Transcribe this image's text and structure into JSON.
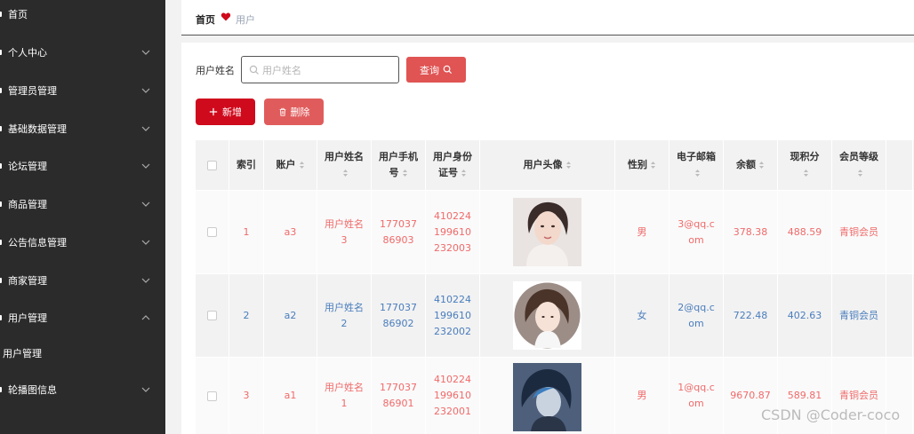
{
  "sidebar": {
    "items": [
      {
        "label": "首页",
        "has_chevron": false
      },
      {
        "label": "个人中心",
        "has_chevron": true
      },
      {
        "label": "管理员管理",
        "has_chevron": true
      },
      {
        "label": "基础数据管理",
        "has_chevron": true
      },
      {
        "label": "论坛管理",
        "has_chevron": true
      },
      {
        "label": "商品管理",
        "has_chevron": true
      },
      {
        "label": "公告信息管理",
        "has_chevron": true
      },
      {
        "label": "商家管理",
        "has_chevron": true
      },
      {
        "label": "用户管理",
        "has_chevron": true,
        "expanded": true
      },
      {
        "label": "用户管理",
        "sub": true
      },
      {
        "label": "轮播图信息",
        "has_chevron": true
      }
    ]
  },
  "breadcrumb": {
    "home": "首页",
    "current": "用户"
  },
  "search": {
    "label": "用户姓名",
    "placeholder": "用户姓名",
    "value": "",
    "button": "查询"
  },
  "actions": {
    "add": "新增",
    "delete": "删除"
  },
  "table": {
    "columns": [
      "索引",
      "账户",
      "用户姓名",
      "用户手机号",
      "用户身份证号",
      "用户头像",
      "性别",
      "电子邮箱",
      "余额",
      "现积分",
      "会员等级"
    ],
    "rows": [
      {
        "index": "1",
        "account": "a3",
        "name": "用户姓名3",
        "phone": "17703786903",
        "idcard": "410224199610232003",
        "avatar": "woman-avatar",
        "gender": "男",
        "email": "3@qq.com",
        "balance": "378.38",
        "points": "488.59",
        "level": "青铜会员",
        "color": "red"
      },
      {
        "index": "2",
        "account": "a2",
        "name": "用户姓名2",
        "phone": "17703786902",
        "idcard": "410224199610232002",
        "avatar": "girl-avatar",
        "gender": "女",
        "email": "2@qq.com",
        "balance": "722.48",
        "points": "402.63",
        "level": "青铜会员",
        "color": "blue"
      },
      {
        "index": "3",
        "account": "a1",
        "name": "用户姓名1",
        "phone": "17703786901",
        "idcard": "410224199610232001",
        "avatar": "boy-avatar",
        "gender": "男",
        "email": "1@qq.com",
        "balance": "9670.87",
        "points": "589.81",
        "level": "青铜会员",
        "color": "red"
      }
    ]
  },
  "watermark": "CSDN @Coder-coco",
  "colors": {
    "sidebar": "#2b2b2b",
    "accent": "#cf0a1c",
    "query": "#e05454",
    "row_red": "#f06a6a",
    "row_blue": "#4a7dbd"
  }
}
